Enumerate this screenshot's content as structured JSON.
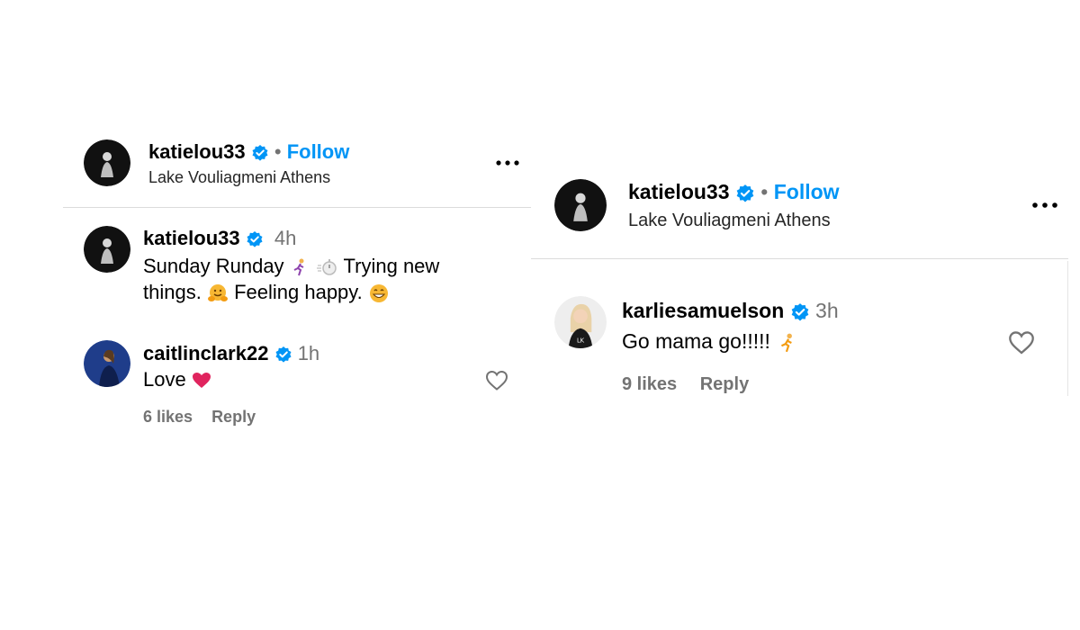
{
  "left": {
    "header": {
      "username": "katielou33",
      "separator": "•",
      "follow_label": "Follow",
      "location": "Lake Vouliagmeni Athens",
      "more_icon": "more-horizontal-icon"
    },
    "caption": {
      "username": "katielou33",
      "time": "4h",
      "line1": "Sunday Runday",
      "line1b": "Trying new",
      "line2a": "things.",
      "line2b": "Feeling happy."
    },
    "comment": {
      "username": "caitlinclark22",
      "time": "1h",
      "text": "Love",
      "likes": "6 likes",
      "reply_label": "Reply"
    }
  },
  "right": {
    "header": {
      "username": "katielou33",
      "separator": "•",
      "follow_label": "Follow",
      "location": "Lake Vouliagmeni Athens",
      "more_icon": "more-horizontal-icon"
    },
    "comment": {
      "username": "karliesamuelson",
      "time": "3h",
      "text": "Go mama go!!!!!",
      "likes": "9 likes",
      "reply_label": "Reply"
    }
  },
  "colors": {
    "link_blue": "#0095f6",
    "verified_blue": "#0095f6",
    "muted_gray": "#737373",
    "divider": "#dbdbdb",
    "heart_red": "#e0245e"
  }
}
